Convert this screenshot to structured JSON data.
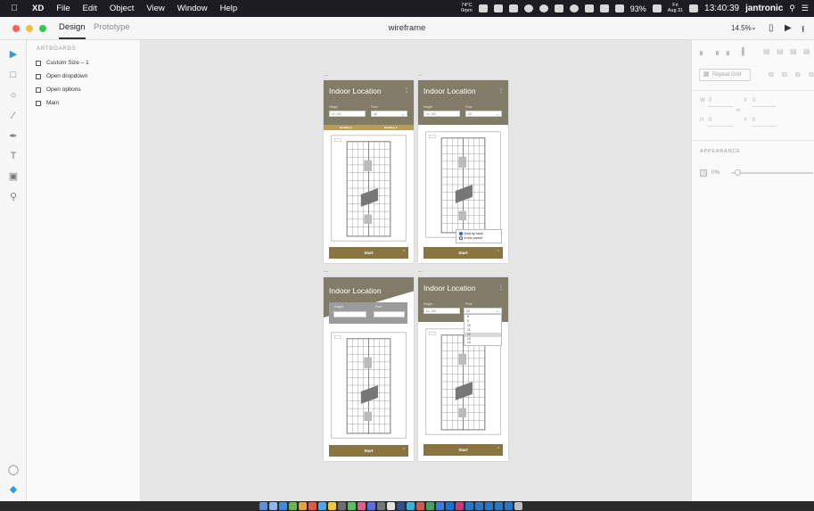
{
  "menubar": {
    "app": "XD",
    "menus": [
      "File",
      "Edit",
      "Object",
      "View",
      "Window",
      "Help"
    ],
    "weather_top": "74°C",
    "weather_bottom": "0rpm",
    "battery": "93%",
    "date_top": "Fri",
    "date_bottom": "Aug 31",
    "clock": "13:40:39",
    "user": "jantronic"
  },
  "titlebar": {
    "tab_design": "Design",
    "tab_prototype": "Prototype",
    "document": "wireframe",
    "zoom": "14.5%"
  },
  "layers": {
    "heading": "ARTBOARDS",
    "items": [
      "Custom Size – 1",
      "Open dropdown",
      "Open options",
      "Main"
    ]
  },
  "boards": {
    "b1": {
      "label": "...",
      "title": "Indoor Location",
      "height_label": "Height",
      "floor_label": "Floor",
      "height_value": "ex. 165",
      "floor_value": "12",
      "tab_left": "Building 1",
      "tab_right": "Building 2",
      "start": "Start"
    },
    "b2": {
      "label": "...",
      "title": "Indoor Location",
      "height_label": "Height",
      "floor_label": "Floor",
      "height_value": "ex. 165",
      "floor_value": "12",
      "start": "Start",
      "option_1": "Hold by hand",
      "option_2": "In the pocket"
    },
    "b3": {
      "label": "...",
      "title": "Indoor Location",
      "height_label": "Height",
      "floor_label": "Floor",
      "start": "Start"
    },
    "b4": {
      "label": "...",
      "title": "Indoor Location",
      "height_label": "Height",
      "floor_label": "Floor",
      "height_value": "ex. 165",
      "floor_value": "12",
      "start": "Start",
      "dropdown": [
        "8",
        "9",
        "10",
        "11",
        "12",
        "13",
        "14"
      ]
    }
  },
  "inspector": {
    "repeat_grid": "Repeat Grid",
    "w_label": "W",
    "w_value": "0",
    "x_label": "X",
    "x_value": "0",
    "h_label": "H",
    "h_value": "0",
    "y_label": "Y",
    "y_value": "0",
    "appearance": "APPEARANCE",
    "opacity": "0%"
  },
  "colors": {
    "header": "#817c68",
    "start_bar": "#8a7540",
    "tabs": "#b79c5c",
    "accent": "#2d9be0"
  }
}
